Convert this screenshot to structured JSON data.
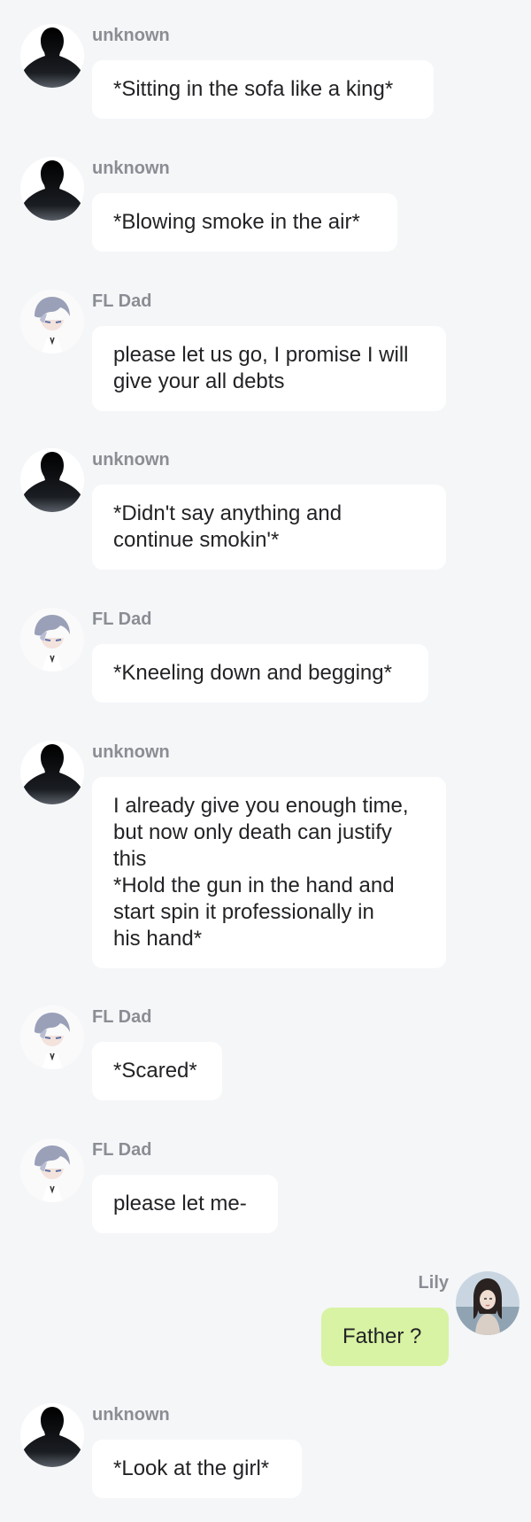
{
  "colors": {
    "background": "#f5f6f8",
    "bubble_in": "#ffffff",
    "bubble_out": "#d8f3a3",
    "name_text": "#8a8d93",
    "message_text": "#222326"
  },
  "messages": [
    {
      "sender": "unknown",
      "avatar": "silhouette-icon",
      "side": "left",
      "text": "*Sitting in the sofa like a king*"
    },
    {
      "sender": "unknown",
      "avatar": "silhouette-icon",
      "side": "left",
      "text": "*Blowing smoke in the air*"
    },
    {
      "sender": "FL Dad",
      "avatar": "anime-character-avatar",
      "side": "left",
      "text": "please let us go, I promise I will\ngive your all debts"
    },
    {
      "sender": "unknown",
      "avatar": "silhouette-icon",
      "side": "left",
      "text": "*Didn't say anything and\ncontinue smokin'*"
    },
    {
      "sender": "FL Dad",
      "avatar": "anime-character-avatar",
      "side": "left",
      "text": "*Kneeling down and begging*"
    },
    {
      "sender": "unknown",
      "avatar": "silhouette-icon",
      "side": "left",
      "text": "I already give you enough time,\nbut now only death can justify\nthis\n*Hold the gun in the hand and\nstart spin it professionally in\nhis hand*"
    },
    {
      "sender": "FL Dad",
      "avatar": "anime-character-avatar",
      "side": "left",
      "text": "*Scared*"
    },
    {
      "sender": "FL Dad",
      "avatar": "anime-character-avatar",
      "side": "left",
      "text": "please let me-"
    },
    {
      "sender": "Lily",
      "avatar": "user-photo-avatar",
      "side": "right",
      "text": "Father ?"
    },
    {
      "sender": "unknown",
      "avatar": "silhouette-icon",
      "side": "left",
      "text": "*Look at the girl*"
    }
  ]
}
